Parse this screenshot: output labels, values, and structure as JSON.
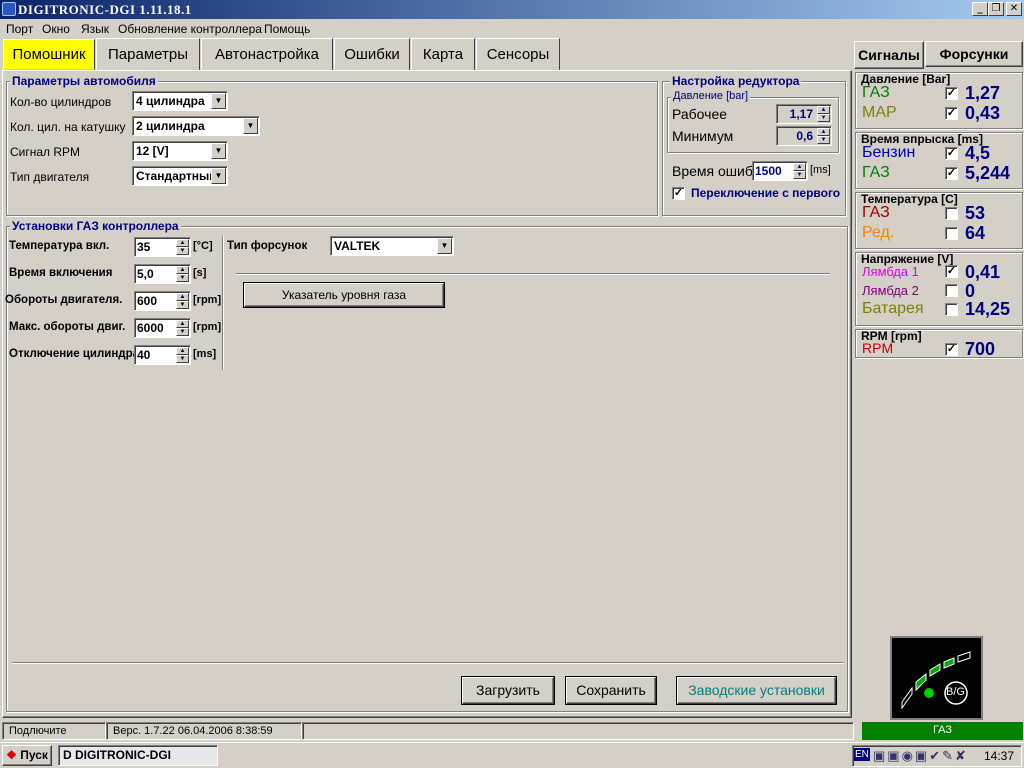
{
  "window": {
    "title": "DIGITRONIC-DGI   1.11.18.1"
  },
  "menu": [
    "Порт",
    "Окно",
    "Язык",
    "Обновление контроллера",
    "Помощь"
  ],
  "tabs": [
    "Помошник",
    "Параметры",
    "Автонастройка",
    "Ошибки",
    "Карта",
    "Сенсоры"
  ],
  "side_tabs": [
    "Сигналы",
    "Форсунки"
  ],
  "car_params": {
    "title": "Параметры автомобиля",
    "rows": [
      {
        "label": "Кол-во цилиндров",
        "value": "4 цилиндра"
      },
      {
        "label": "Кол. цил. на катушку",
        "value": "2 цилиндра"
      },
      {
        "label": "Сигнал RPM",
        "value": "12 [V]"
      },
      {
        "label": "Тип двигателя",
        "value": "Стандартный"
      }
    ]
  },
  "reducer": {
    "title": "Настройка редуктора",
    "pressure_title": "Давление [bar]",
    "working_label": "Рабочее",
    "working_value": "1,17",
    "min_label": "Минимум",
    "min_value": "0,6",
    "error_time_label": "Время ошибки",
    "error_time_value": "1500",
    "error_time_unit": "[ms]",
    "switch_label": "Переключение с первого",
    "switch_checked": "✓"
  },
  "gas_ctrl": {
    "title": "Установки ГАЗ контроллера",
    "rows": [
      {
        "label": "Температура вкл.",
        "value": "35",
        "unit": "[°C]"
      },
      {
        "label": "Время включения",
        "value": "5,0",
        "unit": "[s]"
      },
      {
        "label": "Обороты двигателя.",
        "value": "600",
        "unit": "[rpm]"
      },
      {
        "label": "Макс. обороты двиг.",
        "value": "6000",
        "unit": "[rpm]"
      },
      {
        "label": "Отключение цилиндра",
        "value": "40",
        "unit": "[ms]"
      }
    ],
    "injector_label": "Тип форсунок",
    "injector_value": "VALTEK",
    "gas_level_button": "Указатель уровня газа"
  },
  "buttons": {
    "load": "Загрузить",
    "save": "Сохранить",
    "factory": "Заводские установки"
  },
  "signals": {
    "pressure": {
      "title": "Давление [Bar]",
      "rows": [
        {
          "name": "ГАЗ",
          "color": "#008000",
          "checked": "✓",
          "value": "1,27"
        },
        {
          "name": "MAP",
          "color": "#808000",
          "checked": "✓",
          "value": "0,43"
        }
      ]
    },
    "injection": {
      "title": "Время впрыска [ms]",
      "rows": [
        {
          "name": "Бензин",
          "color": "#0000c0",
          "checked": "✓",
          "value": "4,5"
        },
        {
          "name": "ГАЗ",
          "color": "#008000",
          "checked": "✓",
          "value": "5,244"
        }
      ]
    },
    "temperature": {
      "title": "Температура  [C]",
      "rows": [
        {
          "name": "ГАЗ",
          "color": "#a00000",
          "checked": "",
          "value": "53"
        },
        {
          "name": "Ред.",
          "color": "#ff8000",
          "checked": "",
          "value": "64"
        }
      ]
    },
    "voltage": {
      "title": "Напряжение [V]",
      "rows": [
        {
          "name": "Лямбда 1",
          "color": "#e000e0",
          "checked": "✓",
          "value": "0,41"
        },
        {
          "name": "Лямбда 2",
          "color": "#800080",
          "checked": "",
          "value": "0"
        },
        {
          "name": "Батарея",
          "color": "#808000",
          "checked": "",
          "value": "14,25"
        }
      ]
    },
    "rpm": {
      "title": "RPM [rpm]",
      "rows": [
        {
          "name": "RPM",
          "color": "#c00000",
          "checked": "✓",
          "value": "700"
        }
      ]
    }
  },
  "indicator": {
    "label": "B/G"
  },
  "status": {
    "connect": "Подлючите",
    "version": "Верс. 1.7.22  06.04.2006 8:38:59",
    "mode": "ГАЗ"
  },
  "taskbar": {
    "start": "Пуск",
    "task": "DIGITRONIC-DGI",
    "lang": "EN",
    "time": "14:37"
  }
}
